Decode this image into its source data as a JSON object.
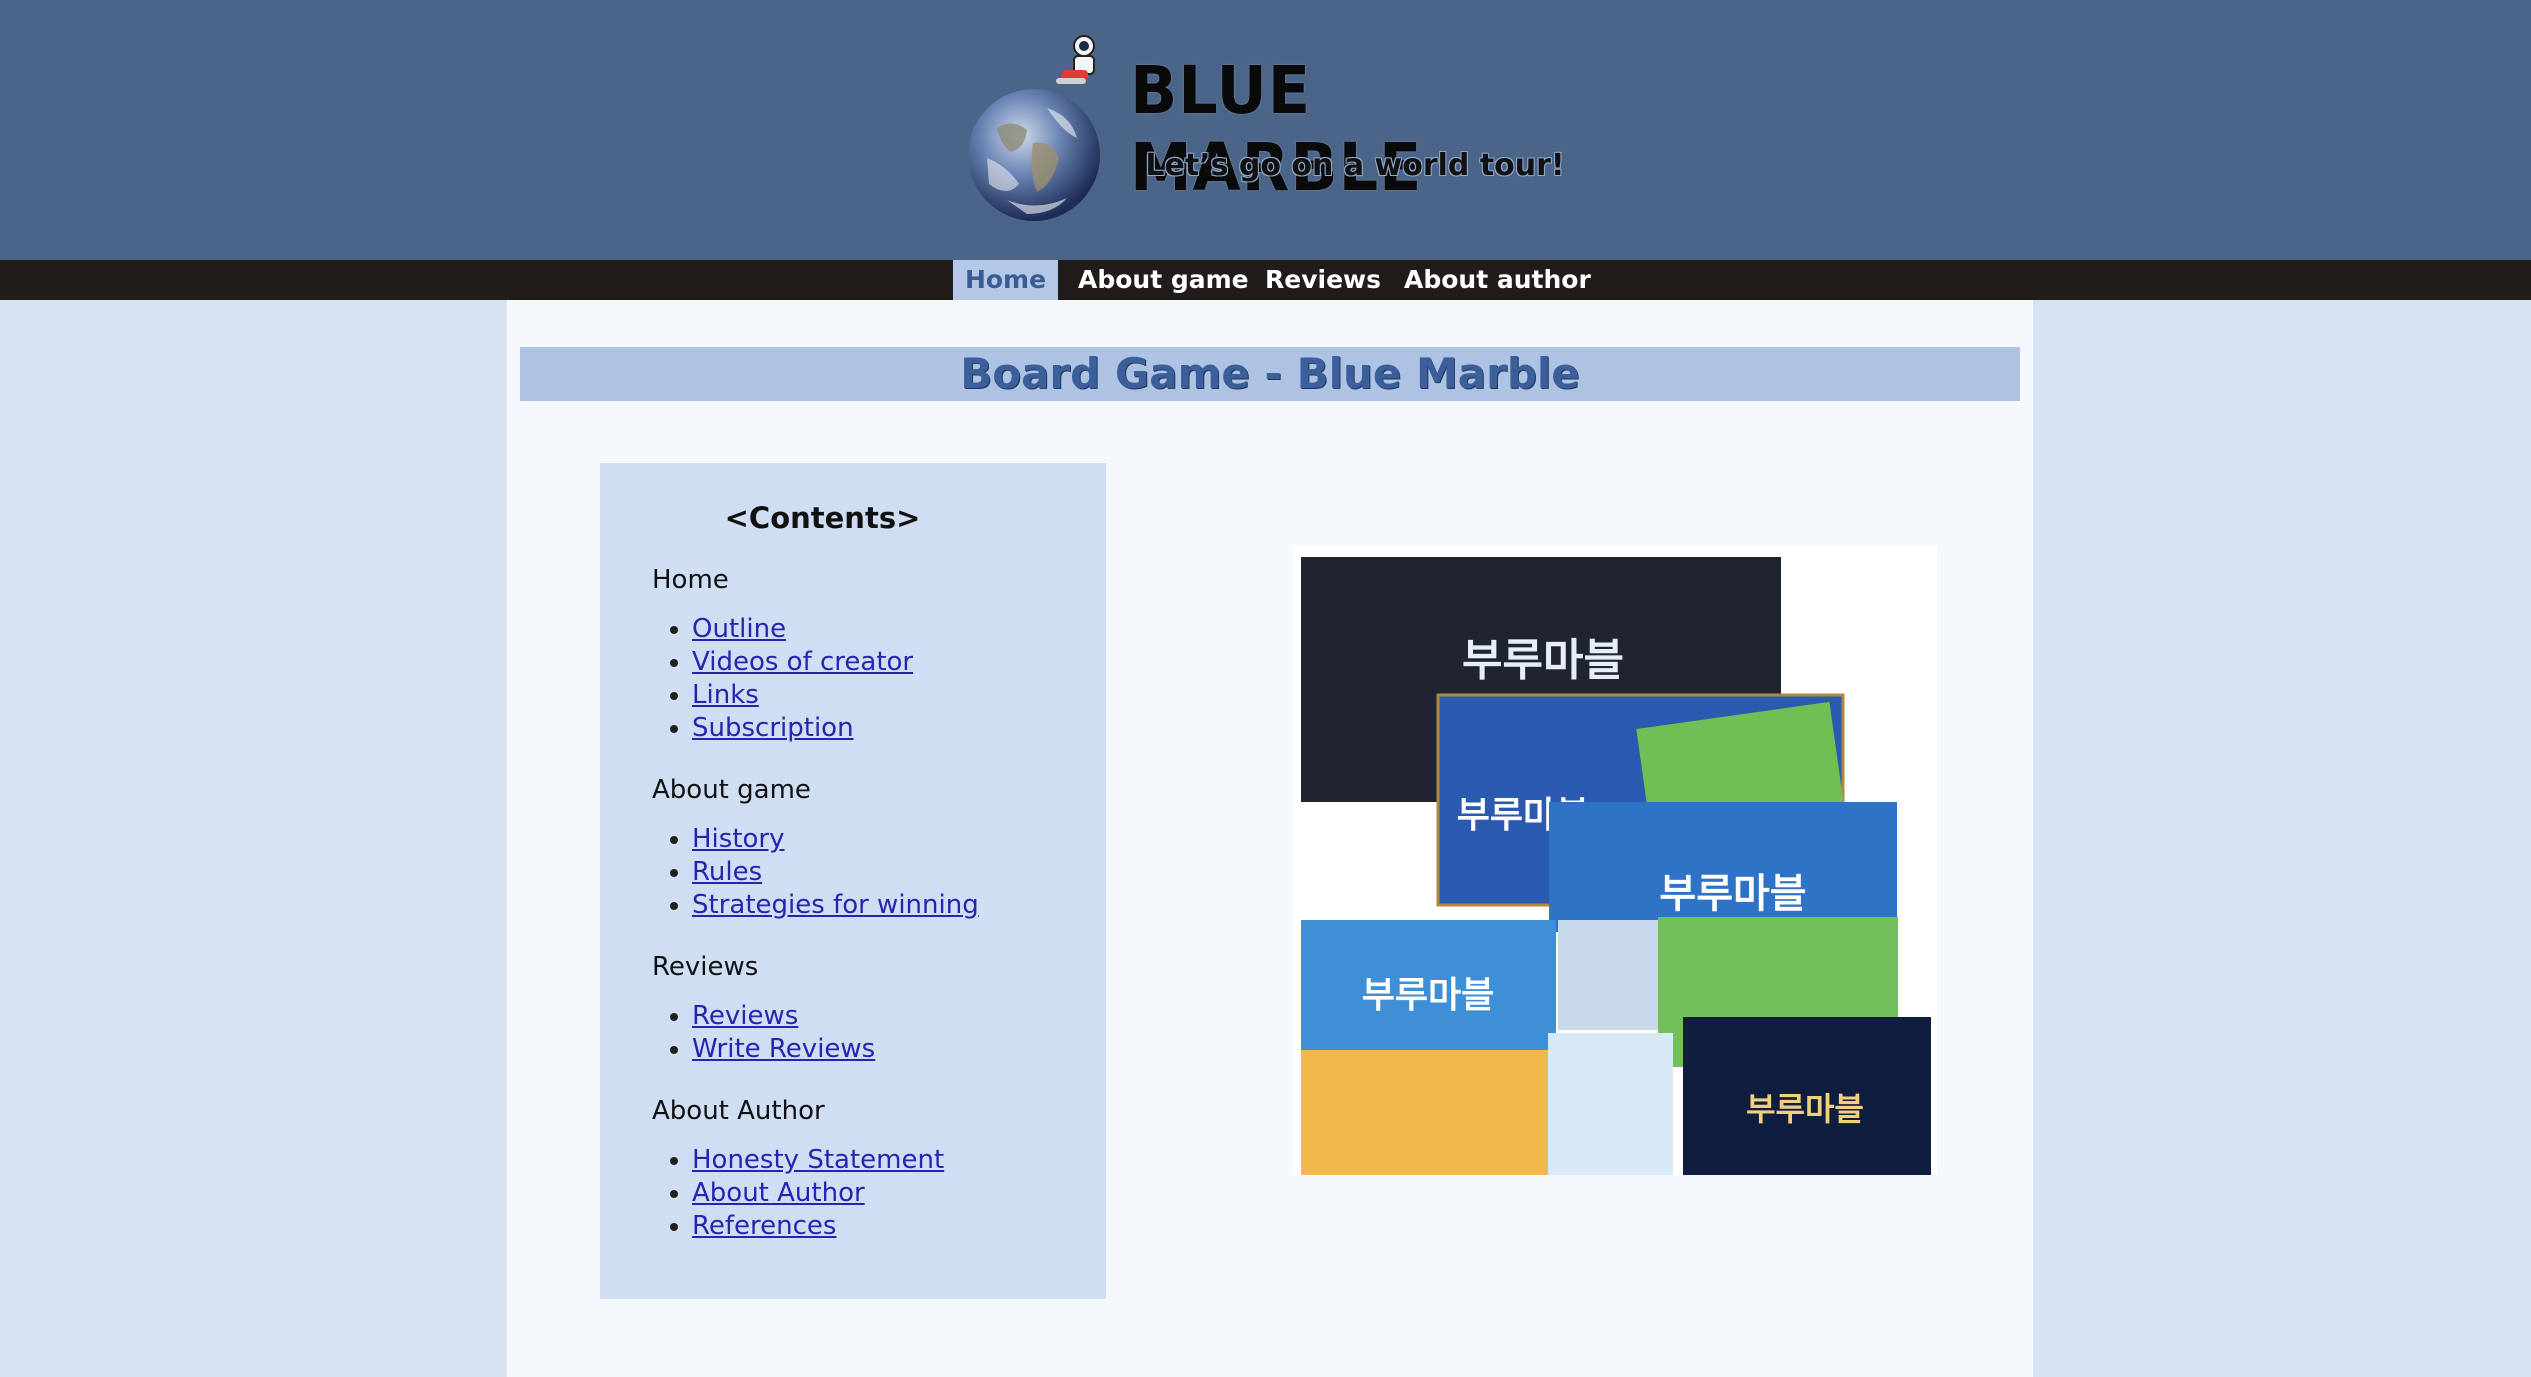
{
  "header": {
    "site_title": "BLUE MARBLE",
    "tagline": "Let’s go on a world tour!"
  },
  "nav": {
    "items": [
      {
        "label": "Home",
        "active": true
      },
      {
        "label": "About game",
        "active": false
      },
      {
        "label": "Reviews",
        "active": false
      },
      {
        "label": "About author",
        "active": false
      }
    ]
  },
  "main": {
    "title": "Board Game - Blue Marble"
  },
  "toc": {
    "title": "<Contents>",
    "sections": [
      {
        "heading": "Home",
        "links": [
          "Outline",
          "Videos of creator",
          "Links",
          "Subscription"
        ]
      },
      {
        "heading": "About game",
        "links": [
          "History",
          "Rules",
          "Strategies for winning"
        ]
      },
      {
        "heading": "Reviews",
        "links": [
          "Reviews",
          "Write Reviews"
        ]
      },
      {
        "heading": "About Author",
        "links": [
          "Honesty Statement",
          "About Author",
          "References"
        ]
      }
    ]
  },
  "image": {
    "box_logo_text": "부루마블"
  },
  "colors": {
    "header_bg": "#4b6589",
    "nav_bg": "#211b19",
    "page_bg": "#d6e4f2",
    "banner_bg": "#aec2e3",
    "toc_bg": "#cfdef3",
    "link": "#2525b0"
  }
}
